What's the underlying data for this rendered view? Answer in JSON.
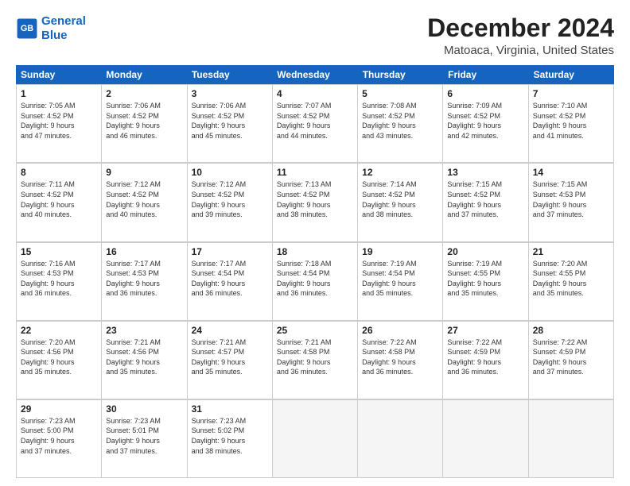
{
  "logo": {
    "line1": "General",
    "line2": "Blue"
  },
  "title": "December 2024",
  "subtitle": "Matoaca, Virginia, United States",
  "days": [
    "Sunday",
    "Monday",
    "Tuesday",
    "Wednesday",
    "Thursday",
    "Friday",
    "Saturday"
  ],
  "weeks": [
    [
      {
        "day": "1",
        "info": "Sunrise: 7:05 AM\nSunset: 4:52 PM\nDaylight: 9 hours\nand 47 minutes."
      },
      {
        "day": "2",
        "info": "Sunrise: 7:06 AM\nSunset: 4:52 PM\nDaylight: 9 hours\nand 46 minutes."
      },
      {
        "day": "3",
        "info": "Sunrise: 7:06 AM\nSunset: 4:52 PM\nDaylight: 9 hours\nand 45 minutes."
      },
      {
        "day": "4",
        "info": "Sunrise: 7:07 AM\nSunset: 4:52 PM\nDaylight: 9 hours\nand 44 minutes."
      },
      {
        "day": "5",
        "info": "Sunrise: 7:08 AM\nSunset: 4:52 PM\nDaylight: 9 hours\nand 43 minutes."
      },
      {
        "day": "6",
        "info": "Sunrise: 7:09 AM\nSunset: 4:52 PM\nDaylight: 9 hours\nand 42 minutes."
      },
      {
        "day": "7",
        "info": "Sunrise: 7:10 AM\nSunset: 4:52 PM\nDaylight: 9 hours\nand 41 minutes."
      }
    ],
    [
      {
        "day": "8",
        "info": "Sunrise: 7:11 AM\nSunset: 4:52 PM\nDaylight: 9 hours\nand 40 minutes."
      },
      {
        "day": "9",
        "info": "Sunrise: 7:12 AM\nSunset: 4:52 PM\nDaylight: 9 hours\nand 40 minutes."
      },
      {
        "day": "10",
        "info": "Sunrise: 7:12 AM\nSunset: 4:52 PM\nDaylight: 9 hours\nand 39 minutes."
      },
      {
        "day": "11",
        "info": "Sunrise: 7:13 AM\nSunset: 4:52 PM\nDaylight: 9 hours\nand 38 minutes."
      },
      {
        "day": "12",
        "info": "Sunrise: 7:14 AM\nSunset: 4:52 PM\nDaylight: 9 hours\nand 38 minutes."
      },
      {
        "day": "13",
        "info": "Sunrise: 7:15 AM\nSunset: 4:52 PM\nDaylight: 9 hours\nand 37 minutes."
      },
      {
        "day": "14",
        "info": "Sunrise: 7:15 AM\nSunset: 4:53 PM\nDaylight: 9 hours\nand 37 minutes."
      }
    ],
    [
      {
        "day": "15",
        "info": "Sunrise: 7:16 AM\nSunset: 4:53 PM\nDaylight: 9 hours\nand 36 minutes."
      },
      {
        "day": "16",
        "info": "Sunrise: 7:17 AM\nSunset: 4:53 PM\nDaylight: 9 hours\nand 36 minutes."
      },
      {
        "day": "17",
        "info": "Sunrise: 7:17 AM\nSunset: 4:54 PM\nDaylight: 9 hours\nand 36 minutes."
      },
      {
        "day": "18",
        "info": "Sunrise: 7:18 AM\nSunset: 4:54 PM\nDaylight: 9 hours\nand 36 minutes."
      },
      {
        "day": "19",
        "info": "Sunrise: 7:19 AM\nSunset: 4:54 PM\nDaylight: 9 hours\nand 35 minutes."
      },
      {
        "day": "20",
        "info": "Sunrise: 7:19 AM\nSunset: 4:55 PM\nDaylight: 9 hours\nand 35 minutes."
      },
      {
        "day": "21",
        "info": "Sunrise: 7:20 AM\nSunset: 4:55 PM\nDaylight: 9 hours\nand 35 minutes."
      }
    ],
    [
      {
        "day": "22",
        "info": "Sunrise: 7:20 AM\nSunset: 4:56 PM\nDaylight: 9 hours\nand 35 minutes."
      },
      {
        "day": "23",
        "info": "Sunrise: 7:21 AM\nSunset: 4:56 PM\nDaylight: 9 hours\nand 35 minutes."
      },
      {
        "day": "24",
        "info": "Sunrise: 7:21 AM\nSunset: 4:57 PM\nDaylight: 9 hours\nand 35 minutes."
      },
      {
        "day": "25",
        "info": "Sunrise: 7:21 AM\nSunset: 4:58 PM\nDaylight: 9 hours\nand 36 minutes."
      },
      {
        "day": "26",
        "info": "Sunrise: 7:22 AM\nSunset: 4:58 PM\nDaylight: 9 hours\nand 36 minutes."
      },
      {
        "day": "27",
        "info": "Sunrise: 7:22 AM\nSunset: 4:59 PM\nDaylight: 9 hours\nand 36 minutes."
      },
      {
        "day": "28",
        "info": "Sunrise: 7:22 AM\nSunset: 4:59 PM\nDaylight: 9 hours\nand 37 minutes."
      }
    ],
    [
      {
        "day": "29",
        "info": "Sunrise: 7:23 AM\nSunset: 5:00 PM\nDaylight: 9 hours\nand 37 minutes."
      },
      {
        "day": "30",
        "info": "Sunrise: 7:23 AM\nSunset: 5:01 PM\nDaylight: 9 hours\nand 37 minutes."
      },
      {
        "day": "31",
        "info": "Sunrise: 7:23 AM\nSunset: 5:02 PM\nDaylight: 9 hours\nand 38 minutes."
      },
      {
        "day": "",
        "info": ""
      },
      {
        "day": "",
        "info": ""
      },
      {
        "day": "",
        "info": ""
      },
      {
        "day": "",
        "info": ""
      }
    ]
  ]
}
